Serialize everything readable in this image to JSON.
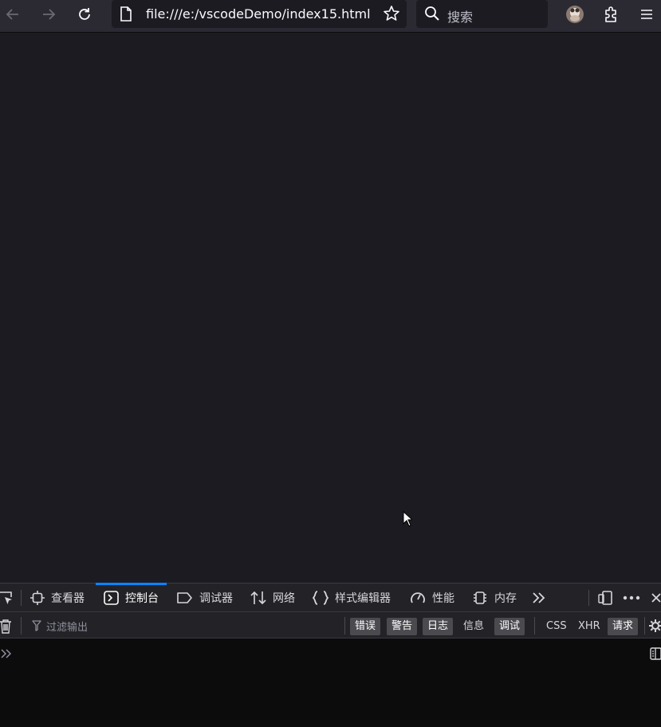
{
  "browser": {
    "url": "file:///e:/vscodeDemo/index15.html",
    "search_placeholder": "搜索",
    "icons": {
      "back": "arrow-left-icon",
      "forward": "arrow-right-icon",
      "reload": "reload-icon",
      "page": "page-icon",
      "bookmark": "star-icon",
      "search": "search-icon",
      "profile": "avatar",
      "extensions": "puzzle-icon",
      "menu": "hamburger-icon"
    }
  },
  "devtools": {
    "tabs": [
      {
        "label": "查看器",
        "icon": "inspector-icon"
      },
      {
        "label": "控制台",
        "icon": "console-icon",
        "selected": true
      },
      {
        "label": "调试器",
        "icon": "debugger-icon"
      },
      {
        "label": "网络",
        "icon": "network-icon"
      },
      {
        "label": "样式编辑器",
        "icon": "style-editor-icon"
      },
      {
        "label": "性能",
        "icon": "performance-icon"
      },
      {
        "label": "内存",
        "icon": "memory-icon"
      }
    ],
    "filter_placeholder": "过滤输出",
    "filter_buttons": [
      {
        "label": "错误",
        "active": true
      },
      {
        "label": "警告",
        "active": true
      },
      {
        "label": "日志",
        "active": true
      },
      {
        "label": "信息",
        "active": false
      },
      {
        "label": "调试",
        "active": true
      }
    ],
    "request_buttons": [
      {
        "label": "CSS",
        "active": false
      },
      {
        "label": "XHR",
        "active": false
      },
      {
        "label": "请求",
        "active": true
      }
    ]
  },
  "colors": {
    "accent": "#0a84ff",
    "toolbar_bg": "#2b2a33",
    "page_bg": "#1c1b22",
    "devtools_bg": "#0c0c0d"
  }
}
